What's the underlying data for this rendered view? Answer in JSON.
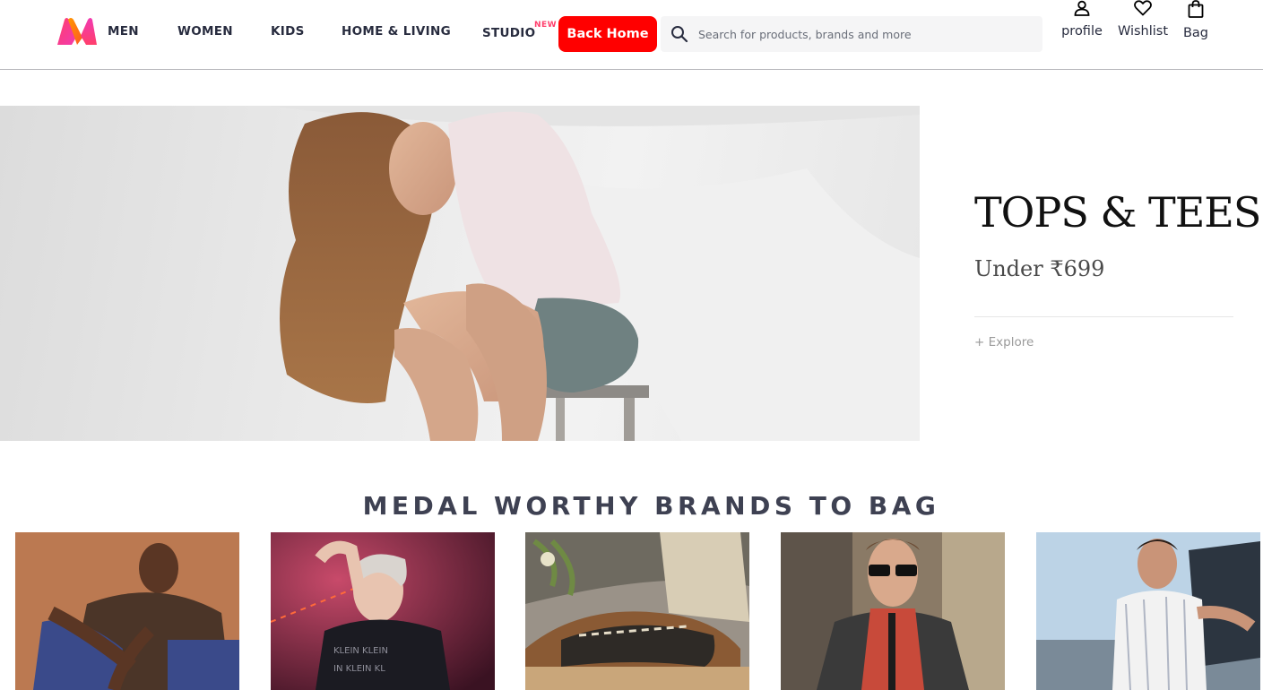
{
  "header": {
    "nav": [
      {
        "label": "MEN"
      },
      {
        "label": "WOMEN"
      },
      {
        "label": "KIDS"
      },
      {
        "label": "HOME & LIVING"
      },
      {
        "label": "STUDIO",
        "badge": "NEW"
      }
    ],
    "back_home_label": "Back Home",
    "search": {
      "placeholder": "Search for products, brands and more",
      "value": ""
    },
    "actions": {
      "profile": "profile",
      "wishlist": "Wishlist",
      "bag": "Bag"
    }
  },
  "hero": {
    "title": "TOPS & TEES",
    "subtitle": "Under ₹699",
    "cta": "+ Explore"
  },
  "section": {
    "title": "MEDAL WORTHY BRANDS TO BAG",
    "cards": [
      {
        "icon": "man-tattoo-photo"
      },
      {
        "icon": "man-neon-photo"
      },
      {
        "icon": "sneakers-photo"
      },
      {
        "icon": "man-sunglasses-photo"
      },
      {
        "icon": "man-car-photo"
      }
    ]
  },
  "colors": {
    "accent": "#ff3f6c",
    "back_home_bg": "#ff0000",
    "text": "#282c3f",
    "search_bg": "#f5f5f6"
  }
}
